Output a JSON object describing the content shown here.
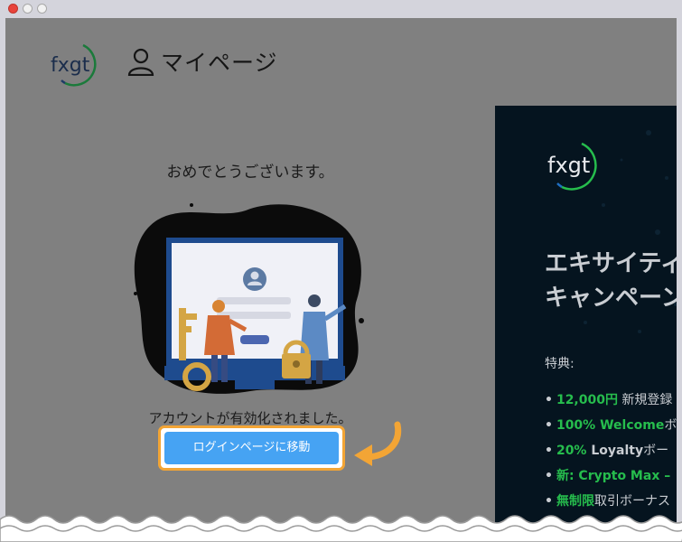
{
  "window": {
    "controls": [
      "close",
      "minimize",
      "maximize"
    ]
  },
  "header": {
    "logo_text": "fxgt",
    "mypage_label": "マイページ",
    "icon": "user-icon"
  },
  "main": {
    "congrats_text": "おめでとうございます。",
    "activated_text": "アカウントが有効化されました。",
    "login_button_label": "ログインページに移動"
  },
  "banner": {
    "logo_text": "fxgt",
    "headline_line1": "エキサイティ",
    "headline_line2": "キャンペーン",
    "perks_title": "特典:",
    "perks": [
      {
        "highlight": "12,000円",
        "rest": " 新規登録"
      },
      {
        "highlight": "100% Welcome",
        "rest": "ボ"
      },
      {
        "highlight": "20%",
        "rest_bold": " Loyalty",
        "rest": "ボー"
      },
      {
        "highlight": "新: Crypto Max –",
        "rest": ""
      },
      {
        "highlight": "無制限",
        "rest": "取引ボーナス"
      }
    ]
  },
  "colors": {
    "overlay": "#808080",
    "button": "#46a3f3",
    "highlight_border": "#f3a535",
    "banner_bg": "#05141f",
    "banner_green": "#26bd4d"
  }
}
